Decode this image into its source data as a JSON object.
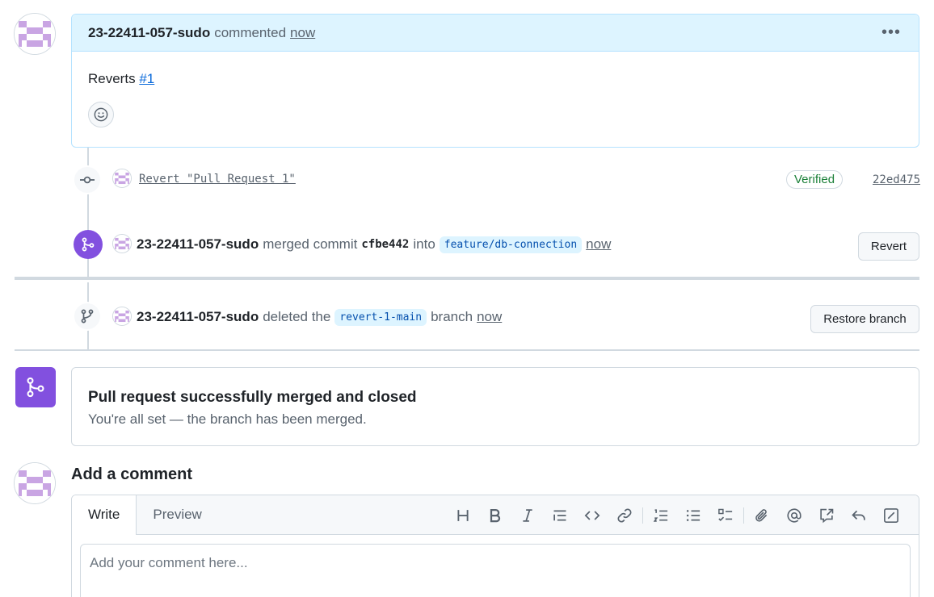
{
  "comment": {
    "author": "23-22411-057-sudo",
    "action": "commented",
    "time": "now",
    "body_prefix": "Reverts",
    "body_link": "#1"
  },
  "commit_event": {
    "message": "Revert \"Pull Request 1\"",
    "verified_label": "Verified",
    "sha": "22ed475"
  },
  "merge_event": {
    "author": "23-22411-057-sudo",
    "action": "merged commit",
    "commit": "cfbe442",
    "into": "into",
    "branch": "feature/db-connection",
    "time": "now",
    "button_label": "Revert"
  },
  "delete_event": {
    "author": "23-22411-057-sudo",
    "action": "deleted the",
    "branch": "revert-1-main",
    "suffix": "branch",
    "time": "now",
    "button_label": "Restore branch"
  },
  "merged_status": {
    "title": "Pull request successfully merged and closed",
    "subtitle": "You're all set — the branch has been merged."
  },
  "add_comment": {
    "title": "Add a comment",
    "tab_write": "Write",
    "tab_preview": "Preview",
    "placeholder": "Add your comment here..."
  },
  "toolbar_icons": [
    "heading-icon",
    "bold-icon",
    "italic-icon",
    "quote-icon",
    "code-icon",
    "link-icon",
    "numbered-list-icon",
    "bullet-list-icon",
    "task-list-icon",
    "attach-icon",
    "mention-icon",
    "cross-reference-icon",
    "reply-icon",
    "fullscreen-icon"
  ],
  "colors": {
    "accent": "#0969da",
    "merged_purple": "#8250df",
    "verified_green": "#1a7f37",
    "comment_header_bg": "#ddf4ff"
  }
}
